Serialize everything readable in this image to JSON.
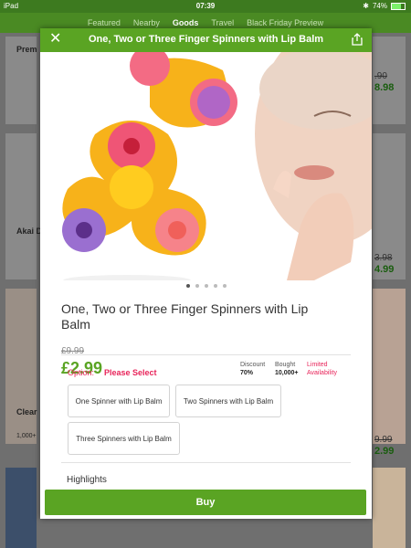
{
  "status_bar": {
    "device": "iPad",
    "time": "07:39",
    "battery": "74%"
  },
  "nav": {
    "tabs": [
      "Featured",
      "Nearby",
      "Goods",
      "Travel",
      "Black Friday Preview"
    ],
    "active": "Goods"
  },
  "background": {
    "left_titles": [
      "Prem",
      "Akai D",
      "Clear"
    ],
    "left_extra": "1,000+",
    "right_old_prices": [
      ".90",
      "3.98",
      "9.99"
    ],
    "right_prices": [
      "8.98",
      "4.99",
      "2.99"
    ]
  },
  "modal": {
    "title": "One, Two or Three Finger Spinners with Lip Balm",
    "product_title": "One, Two or Three Finger Spinners with Lip Balm",
    "old_price": "£9.99",
    "price": "£2.99",
    "stats": {
      "discount_label": "Discount",
      "discount_value": "70%",
      "bought_label": "Bought",
      "bought_value": "10,000+",
      "limited_line1": "Limited",
      "limited_line2": "Availability"
    },
    "option_label": "Option:",
    "option_select": "Please Select",
    "options": [
      "One Spinner with Lip Balm",
      "Two Spinners with Lip Balm",
      "Three Spinners with Lip Balm"
    ],
    "highlights": "Highlights",
    "buy": "Buy",
    "carousel": {
      "count": 5,
      "active": 1
    }
  },
  "colors": {
    "brand_green": "#5aa423",
    "accent_red": "#e8245a"
  }
}
